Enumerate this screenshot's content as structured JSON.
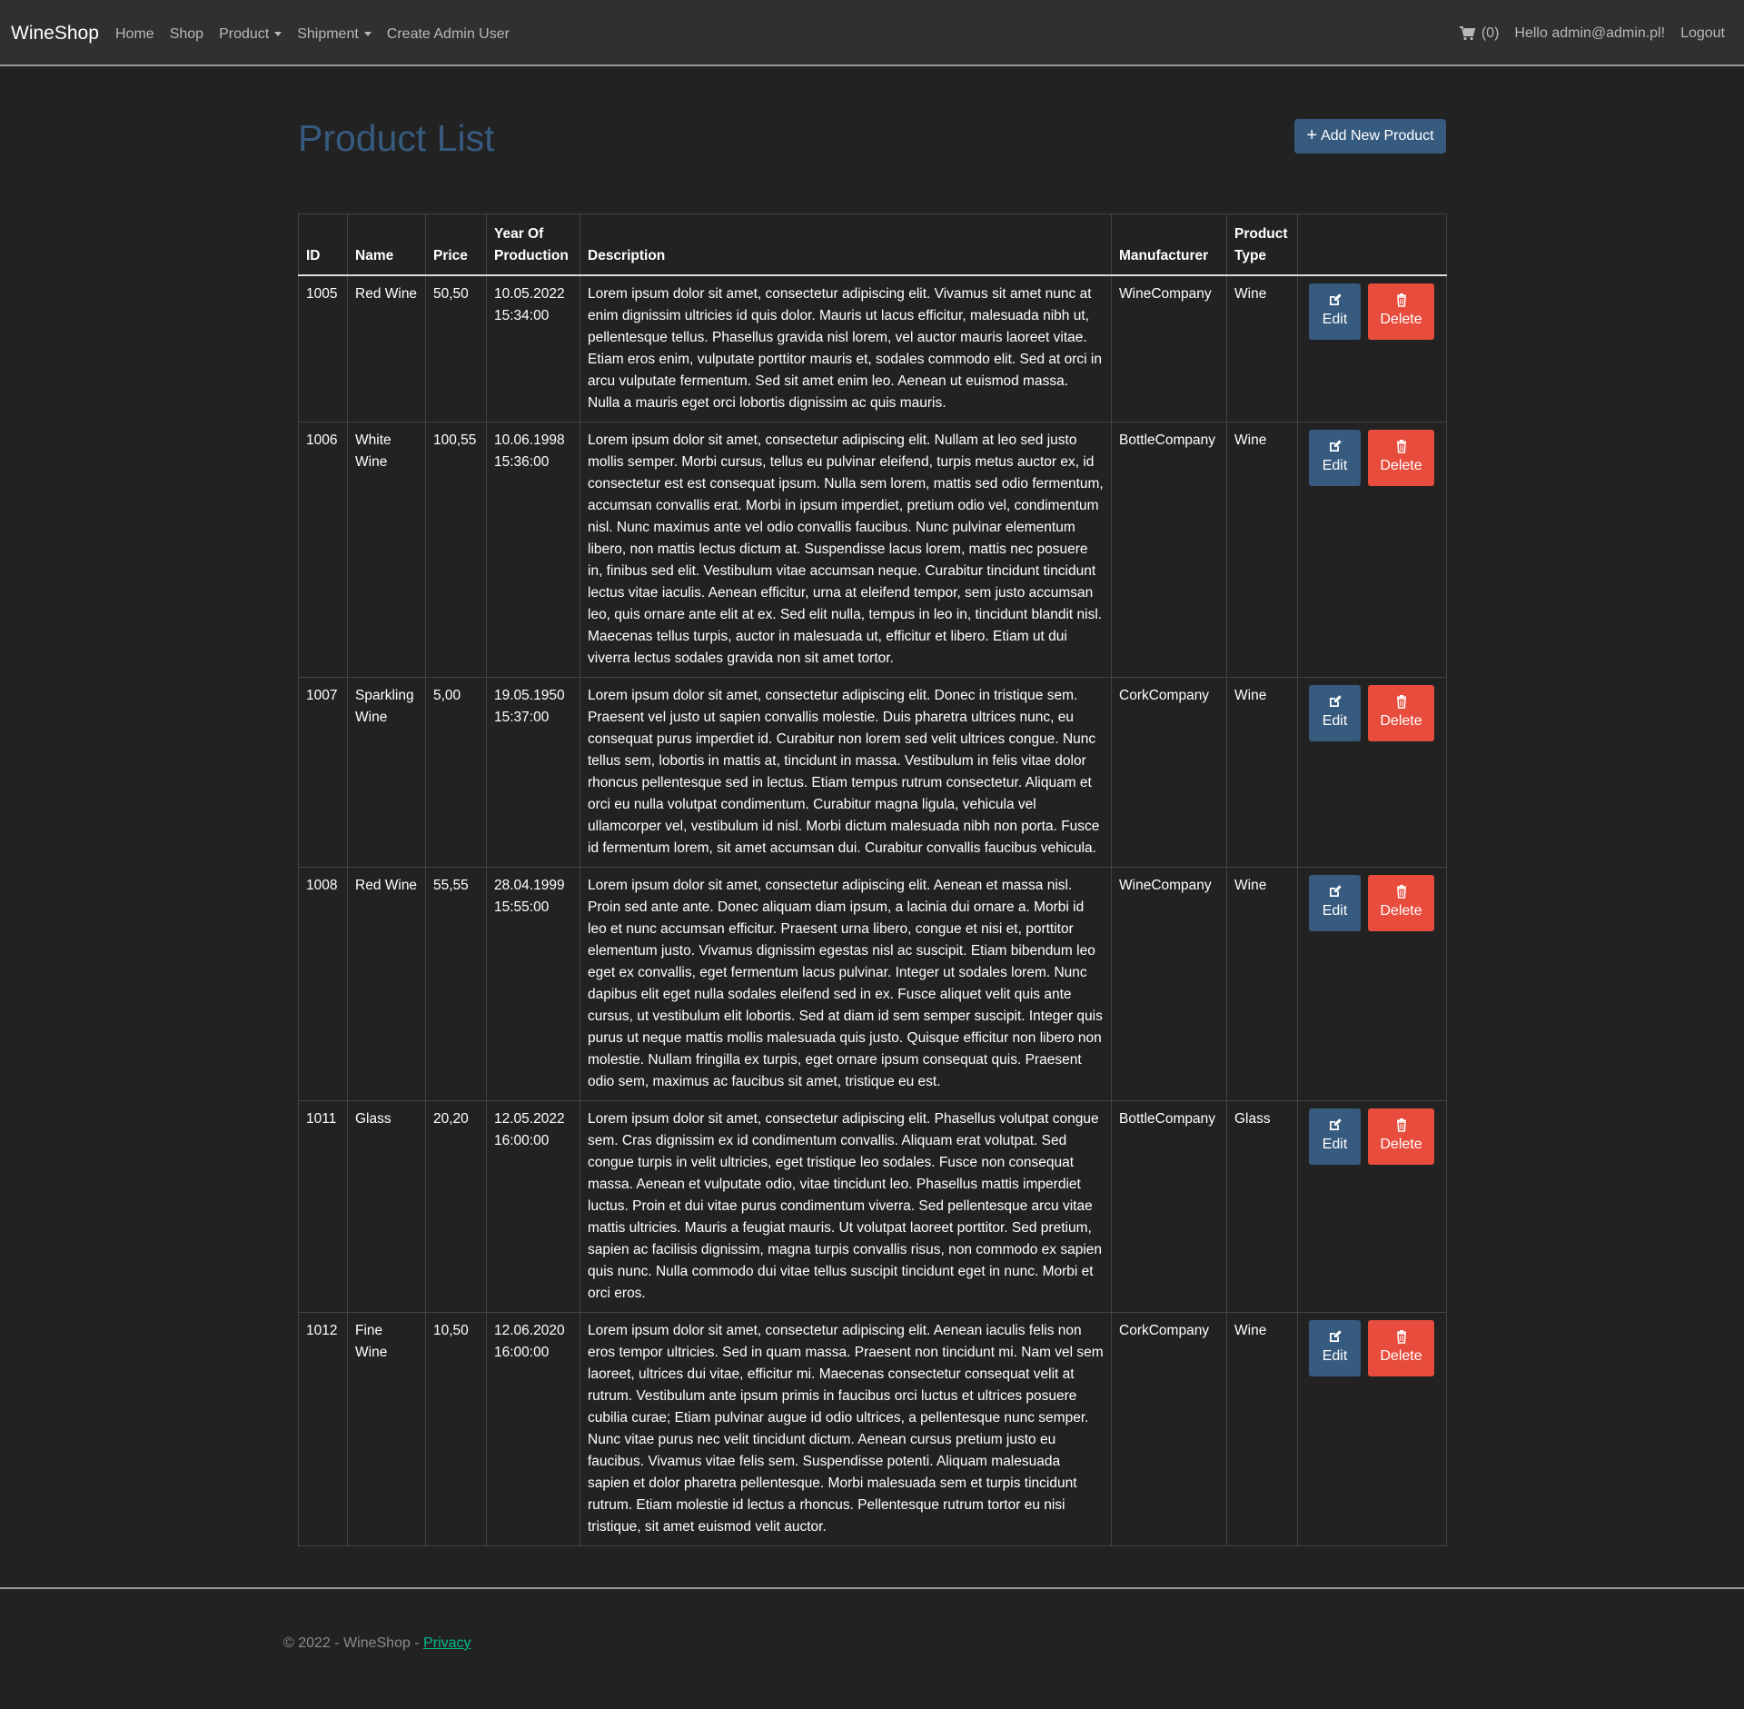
{
  "nav": {
    "brand": "WineShop",
    "items": [
      "Home",
      "Shop",
      "Product",
      "Shipment",
      "Create Admin User"
    ],
    "cart_count": "(0)",
    "greeting": "Hello admin@admin.pl!",
    "logout": "Logout"
  },
  "page": {
    "title": "Product List",
    "add_button": "Add New Product"
  },
  "table": {
    "headers": {
      "id": "ID",
      "name": "Name",
      "price": "Price",
      "year": "Year Of Production",
      "description": "Description",
      "manufacturer": "Manufacturer",
      "type": "Product Type"
    },
    "edit_label": "Edit",
    "delete_label": "Delete",
    "rows": [
      {
        "id": "1005",
        "name": "Red Wine",
        "price": "50,50",
        "date": "10.05.2022",
        "time": "15:34:00",
        "description": "Lorem ipsum dolor sit amet, consectetur adipiscing elit. Vivamus sit amet nunc at enim dignissim ultricies id quis dolor. Mauris ut lacus efficitur, malesuada nibh ut, pellentesque tellus. Phasellus gravida nisl lorem, vel auctor mauris laoreet vitae. Etiam eros enim, vulputate porttitor mauris et, sodales commodo elit. Sed at orci in arcu vulputate fermentum. Sed sit amet enim leo. Aenean ut euismod massa. Nulla a mauris eget orci lobortis dignissim ac quis mauris.",
        "manufacturer": "WineCompany",
        "type": "Wine"
      },
      {
        "id": "1006",
        "name": "White Wine",
        "price": "100,55",
        "date": "10.06.1998",
        "time": "15:36:00",
        "description": "Lorem ipsum dolor sit amet, consectetur adipiscing elit. Nullam at leo sed justo mollis semper. Morbi cursus, tellus eu pulvinar eleifend, turpis metus auctor ex, id consectetur est est consequat ipsum. Nulla sem lorem, mattis sed odio fermentum, accumsan convallis erat. Morbi in ipsum imperdiet, pretium odio vel, condimentum nisl. Nunc maximus ante vel odio convallis faucibus. Nunc pulvinar elementum libero, non mattis lectus dictum at. Suspendisse lacus lorem, mattis nec posuere in, finibus sed elit. Vestibulum vitae accumsan neque. Curabitur tincidunt tincidunt lectus vitae iaculis. Aenean efficitur, urna at eleifend tempor, sem justo accumsan leo, quis ornare ante elit at ex. Sed elit nulla, tempus in leo in, tincidunt blandit nisl. Maecenas tellus turpis, auctor in malesuada ut, efficitur et libero. Etiam ut dui viverra lectus sodales gravida non sit amet tortor.",
        "manufacturer": "BottleCompany",
        "type": "Wine"
      },
      {
        "id": "1007",
        "name": "Sparkling Wine",
        "price": "5,00",
        "date": "19.05.1950",
        "time": "15:37:00",
        "description": "Lorem ipsum dolor sit amet, consectetur adipiscing elit. Donec in tristique sem. Praesent vel justo ut sapien convallis molestie. Duis pharetra ultrices nunc, eu consequat purus imperdiet id. Curabitur non lorem sed velit ultrices congue. Nunc tellus sem, lobortis in mattis at, tincidunt in massa. Vestibulum in felis vitae dolor rhoncus pellentesque sed in lectus. Etiam tempus rutrum consectetur. Aliquam et orci eu nulla volutpat condimentum. Curabitur magna ligula, vehicula vel ullamcorper vel, vestibulum id nisl. Morbi dictum malesuada nibh non porta. Fusce id fermentum lorem, sit amet accumsan dui. Curabitur convallis faucibus vehicula.",
        "manufacturer": "CorkCompany",
        "type": "Wine"
      },
      {
        "id": "1008",
        "name": "Red Wine",
        "price": "55,55",
        "date": "28.04.1999",
        "time": "15:55:00",
        "description": "Lorem ipsum dolor sit amet, consectetur adipiscing elit. Aenean et massa nisl. Proin sed ante ante. Donec aliquam diam ipsum, a lacinia dui ornare a. Morbi id leo et nunc accumsan efficitur. Praesent urna libero, congue et nisi et, porttitor elementum justo. Vivamus dignissim egestas nisl ac suscipit. Etiam bibendum leo eget ex convallis, eget fermentum lacus pulvinar. Integer ut sodales lorem. Nunc dapibus elit eget nulla sodales eleifend sed in ex. Fusce aliquet velit quis ante cursus, ut vestibulum elit lobortis. Sed at diam id sem semper suscipit. Integer quis purus ut neque mattis mollis malesuada quis justo. Quisque efficitur non libero non molestie. Nullam fringilla ex turpis, eget ornare ipsum consequat quis. Praesent odio sem, maximus ac faucibus sit amet, tristique eu est.",
        "manufacturer": "WineCompany",
        "type": "Wine"
      },
      {
        "id": "1011",
        "name": "Glass",
        "price": "20,20",
        "date": "12.05.2022",
        "time": "16:00:00",
        "description": "Lorem ipsum dolor sit amet, consectetur adipiscing elit. Phasellus volutpat congue sem. Cras dignissim ex id condimentum convallis. Aliquam erat volutpat. Sed congue turpis in velit ultricies, eget tristique leo sodales. Fusce non consequat massa. Aenean et vulputate odio, vitae tincidunt leo. Phasellus mattis imperdiet luctus. Proin et dui vitae purus condimentum viverra. Sed pellentesque arcu vitae mattis ultricies. Mauris a feugiat mauris. Ut volutpat laoreet porttitor. Sed pretium, sapien ac facilisis dignissim, magna turpis convallis risus, non commodo ex sapien quis nunc. Nulla commodo dui vitae tellus suscipit tincidunt eget in nunc. Morbi et orci eros.",
        "manufacturer": "BottleCompany",
        "type": "Glass"
      },
      {
        "id": "1012",
        "name": "Fine Wine",
        "price": "10,50",
        "date": "12.06.2020",
        "time": "16:00:00",
        "description": "Lorem ipsum dolor sit amet, consectetur adipiscing elit. Aenean iaculis felis non eros tempor ultricies. Sed in quam massa. Praesent non tincidunt mi. Nam vel sem laoreet, ultrices dui vitae, efficitur mi. Maecenas consectetur consequat velit at rutrum. Vestibulum ante ipsum primis in faucibus orci luctus et ultrices posuere cubilia curae; Etiam pulvinar augue id odio ultrices, a pellentesque nunc semper. Nunc vitae purus nec velit tincidunt dictum. Aenean cursus pretium justo eu faucibus. Vivamus vitae felis sem. Suspendisse potenti. Aliquam malesuada sapien et dolor pharetra pellentesque. Morbi malesuada sem et turpis tincidunt rutrum. Etiam molestie id lectus a rhoncus. Pellentesque rutrum tortor eu nisi tristique, sit amet euismod velit auctor.",
        "manufacturer": "CorkCompany",
        "type": "Wine"
      }
    ]
  },
  "footer": {
    "copyright": "© 2022 - WineShop - ",
    "privacy": "Privacy"
  },
  "colors": {
    "background": "#222222",
    "navbar": "#303030",
    "primary": "#375a7f",
    "danger": "#e74c3c",
    "link": "#00bc8c"
  },
  "icons": [
    "cart-icon",
    "plus-icon",
    "edit-icon",
    "trash-icon",
    "caret-down-icon"
  ]
}
